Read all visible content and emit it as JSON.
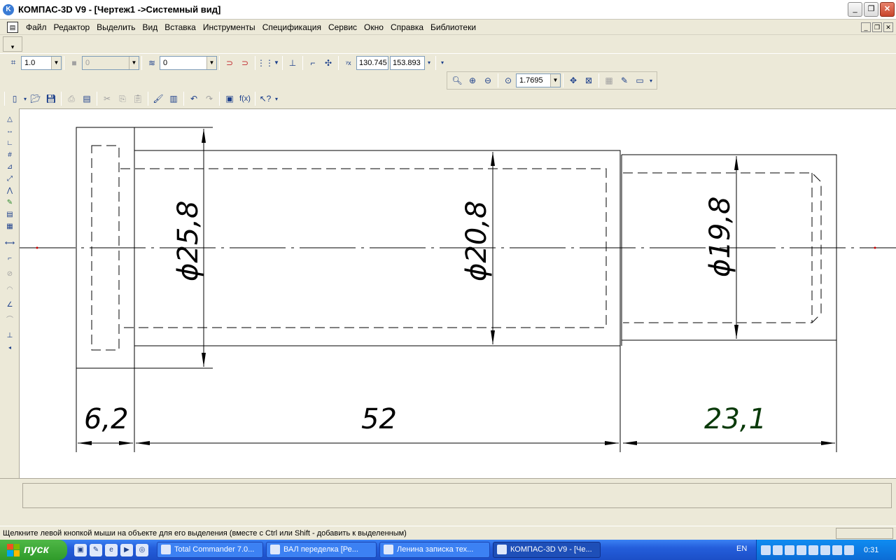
{
  "window": {
    "title": "КОМПАС-3D V9 - [Чертеж1 ->Системный вид]",
    "app_icon": "kompas-icon",
    "min": "_",
    "max": "❐",
    "close": "✕"
  },
  "menu": {
    "items": [
      "Файл",
      "Редактор",
      "Выделить",
      "Вид",
      "Вставка",
      "Инструменты",
      "Спецификация",
      "Сервис",
      "Окно",
      "Справка",
      "Библиотеки"
    ],
    "mdi": [
      "_",
      "❐",
      "✕"
    ]
  },
  "toolbar_current": {
    "step_value": "1.0",
    "layer_value": "0",
    "style_value": "0",
    "coord_x": "130.745",
    "coord_y": "153.893"
  },
  "toolbar_view": {
    "zoom_value": "1.7695"
  },
  "drawing": {
    "dimensions": {
      "d1": "ϕ25,8",
      "d2": "ϕ20,8",
      "d3": "ϕ19,8",
      "len1": "6,2",
      "len2": "52",
      "len3": "23,1"
    },
    "line_color": "#000000",
    "axis_color": "#000000"
  },
  "statusbar": {
    "hint": "Щелкните левой кнопкой мыши на объекте для его выделения (вместе с Ctrl или Shift - добавить к выделенным)"
  },
  "taskbar": {
    "start_label": "пуск",
    "tasks": [
      "Total Commander 7.0...",
      "ВАЛ переделка [Ре...",
      "Ленина записка тех...",
      "КОМПАС-3D V9 - [Че..."
    ],
    "lang": "EN",
    "clock": "0:31"
  }
}
